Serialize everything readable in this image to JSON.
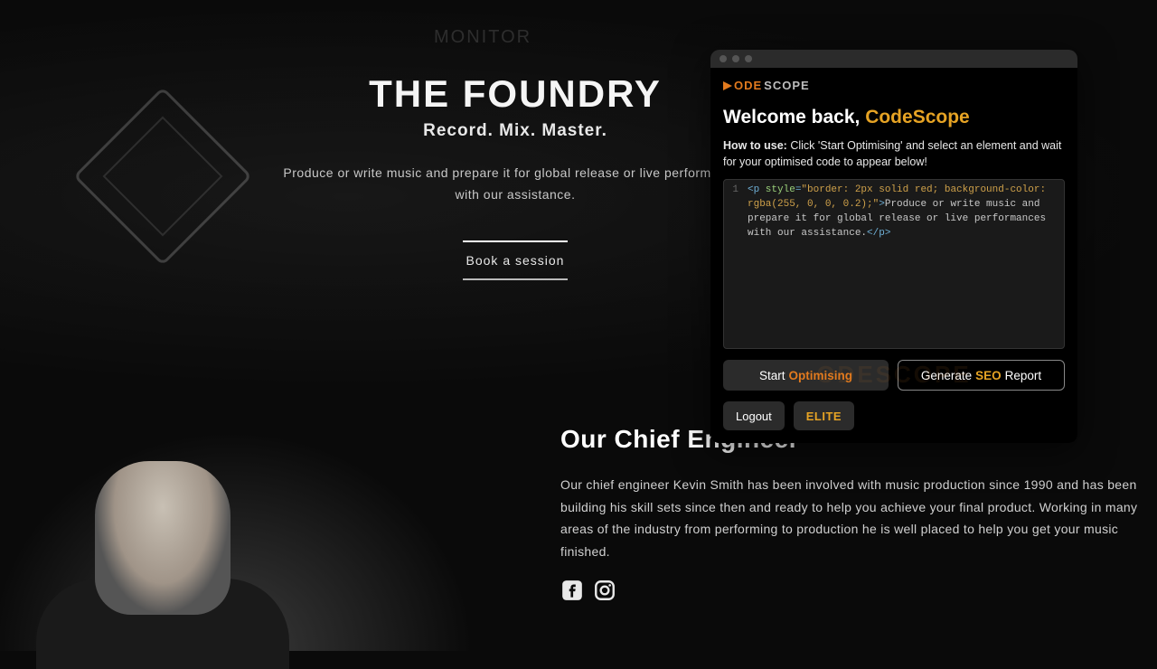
{
  "hero": {
    "bg_monitor": "MONITOR",
    "title": "THE FOUNDRY",
    "subtitle": "Record. Mix. Master.",
    "description": "Produce or write music and prepare it for global release or live performances with our assistance.",
    "cta": "Book a session"
  },
  "engineer": {
    "title": "Our Chief Engineer",
    "body": "Our chief engineer Kevin Smith has been involved with music production since 1990 and has been building his skill sets since then and ready to help you achieve your final product. Working in many areas of the industry from performing to production he is well placed to help you get your music finished."
  },
  "popup": {
    "brand_part1": "ODE",
    "brand_part2": "SCOPE",
    "welcome_prefix": "Welcome back, ",
    "welcome_name": "CodeScope",
    "howto_label": "How to use:",
    "howto_text": " Click 'Start Optimising' and select an element and wait for your optimised code to appear below!",
    "code": {
      "line_num": "1",
      "tag_open": "<p",
      "attr_name": " style",
      "eq": "=",
      "attr_value": "\"border: 2px solid red; background-color: rgba(255, 0, 0, 0.2);\"",
      "gt": ">",
      "text": "Produce or write music and prepare it for global release or live performances with our assistance.",
      "tag_close": "</p>"
    },
    "buttons": {
      "start_prefix": "Start",
      "start_hl": "Optimising",
      "gen_prefix": "Generate",
      "gen_hl": "SEO",
      "gen_suffix": "Report",
      "logout": "Logout",
      "elite": "ELITE"
    },
    "watermark": "ODESCOPE"
  }
}
